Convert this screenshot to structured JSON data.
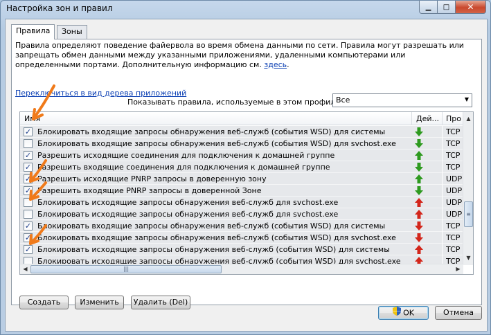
{
  "window": {
    "title": "Настройка зон и правил"
  },
  "tabs": [
    {
      "label": "Правила",
      "active": true
    },
    {
      "label": "Зоны",
      "active": false
    }
  ],
  "description": {
    "text": "Правила определяют поведение файервола во время обмена данными по сети. Правила могут разрешать или запрещать обмен данными между указанными приложениями, удаленными компьютерами или определенными портами. Дополнительную информацию см.",
    "link": "здесь",
    "end": "."
  },
  "switch_view_link": "Переключиться в вид дерева приложений",
  "profile": {
    "label": "Показывать правила, используемые в этом профиле:",
    "value": "Все"
  },
  "grid": {
    "columns": [
      "Имя",
      "Дей...",
      "Про"
    ],
    "rows": [
      {
        "checked": true,
        "name": "Блокировать входящие запросы обнаружения веб-служб (события WSD) для системы",
        "action": "allow-in",
        "protocol": "TCP"
      },
      {
        "checked": false,
        "name": "Блокировать входящие запросы обнаружения веб-служб (события WSD) для svchost.exe",
        "action": "allow-in",
        "protocol": "TCP"
      },
      {
        "checked": true,
        "name": "Разрешить исходящие соединения для подключения к домашней группе",
        "action": "allow-out",
        "protocol": "TCP"
      },
      {
        "checked": true,
        "name": "Разрешить входящие соединения для подключения к домашней группе",
        "action": "allow-in",
        "protocol": "TCP"
      },
      {
        "checked": true,
        "name": "Разрешить исходящие PNRP запросы в доверенную зону",
        "action": "allow-out",
        "protocol": "UDP"
      },
      {
        "checked": true,
        "name": "Разрешить входящие PNRP запросы в доверенной Зоне",
        "action": "allow-in",
        "protocol": "UDP"
      },
      {
        "checked": false,
        "name": "Блокировать исходящие запросы обнаружения веб-служб для svchost.exe",
        "action": "block-out",
        "protocol": "UDP"
      },
      {
        "checked": false,
        "name": "Блокировать исходящие запросы обнаружения веб-служб для svchost.exe",
        "action": "block-out",
        "protocol": "UDP"
      },
      {
        "checked": true,
        "name": "Блокировать входящие запросы обнаружения веб-служб (события WSD) для системы",
        "action": "block-in",
        "protocol": "TCP"
      },
      {
        "checked": true,
        "name": "Блокировать входящие запросы обнаружения веб-служб (события WSD) для svchost.exe",
        "action": "block-in",
        "protocol": "TCP"
      },
      {
        "checked": true,
        "name": "Блокировать исходящие запросы обнаружения веб-служб (события WSD) для системы",
        "action": "block-out",
        "protocol": "TCP"
      },
      {
        "checked": false,
        "name": "Блокировать исходящие запросы обнаружения веб-служб (события WSD) для svchost.exe",
        "action": "block-out",
        "protocol": "TCP"
      }
    ]
  },
  "buttons": {
    "create": "Создать",
    "edit": "Изменить",
    "delete": "Удалить (Del)",
    "ok": "OK",
    "cancel": "Отмена"
  },
  "colors": {
    "allow": "#2e9a1f",
    "block": "#d3261b",
    "annotation": "#f07a1a"
  }
}
